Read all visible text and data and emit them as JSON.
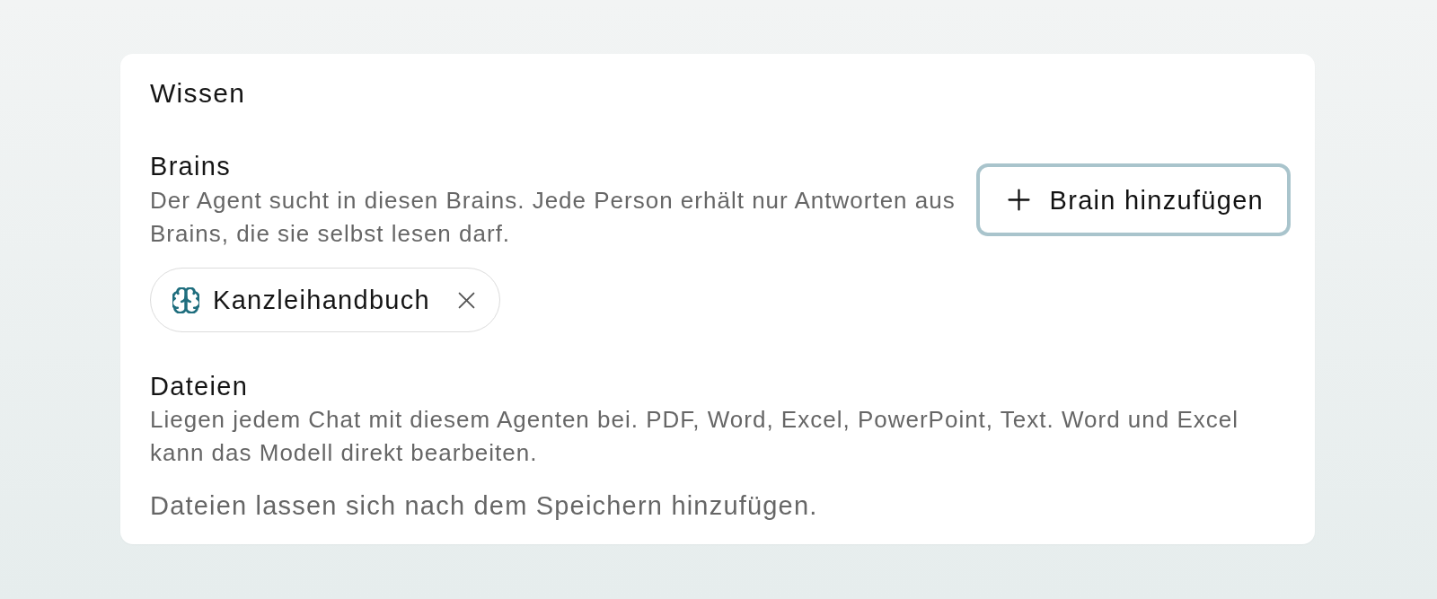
{
  "card": {
    "title": "Wissen"
  },
  "brains": {
    "heading": "Brains",
    "description": "Der Agent sucht in diesen Brains. Jede Person erhält nur Antworten aus Brains, die sie selbst lesen darf.",
    "add_button": {
      "label": "Brain hinzufügen",
      "focused": true
    },
    "items": [
      {
        "label": "Kanzleihandbuch"
      }
    ]
  },
  "files": {
    "heading": "Dateien",
    "description": "Liegen jedem Chat mit diesem Agenten bei. PDF, Word, Excel, PowerPoint, Text. Word und Excel kann das Modell direkt bearbeiten.",
    "note": "Dateien lassen sich nach dem Speichern hinzufügen."
  }
}
